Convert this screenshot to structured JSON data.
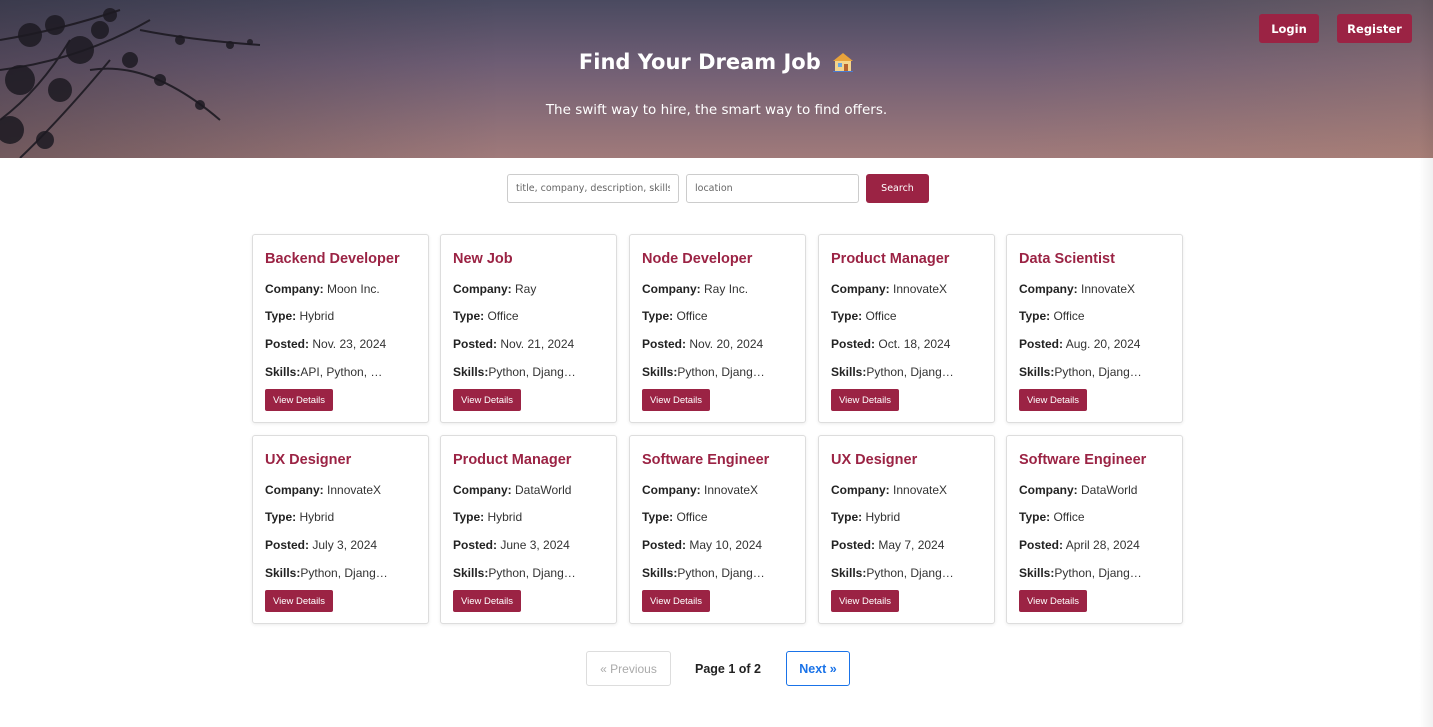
{
  "header": {
    "title": "Find Your Dream Job",
    "title_icon": "house-emoji",
    "subtitle": "The swift way to hire, the smart way to find offers.",
    "login_label": "Login",
    "register_label": "Register"
  },
  "search": {
    "query_placeholder": "title, company, description, skills",
    "query_value": "",
    "location_placeholder": "location",
    "location_value": "",
    "button_label": "Search"
  },
  "jobs": [
    {
      "title": "Backend Developer",
      "company": "Moon Inc.",
      "type": "Hybrid",
      "posted": "Nov. 23, 2024",
      "skills": "API, Python, …"
    },
    {
      "title": "New Job",
      "company": "Ray",
      "type": "Office",
      "posted": "Nov. 21, 2024",
      "skills": "Python, Djang…"
    },
    {
      "title": "Node Developer",
      "company": "Ray Inc.",
      "type": "Office",
      "posted": "Nov. 20, 2024",
      "skills": "Python, Djang…"
    },
    {
      "title": "Product Manager",
      "company": "InnovateX",
      "type": "Office",
      "posted": "Oct. 18, 2024",
      "skills": "Python, Djang…"
    },
    {
      "title": "Data Scientist",
      "company": "InnovateX",
      "type": "Office",
      "posted": "Aug. 20, 2024",
      "skills": "Python, Djang…"
    },
    {
      "title": "UX Designer",
      "company": "InnovateX",
      "type": "Hybrid",
      "posted": "July 3, 2024",
      "skills": "Python, Djang…"
    },
    {
      "title": "Product Manager",
      "company": "DataWorld",
      "type": "Hybrid",
      "posted": "June 3, 2024",
      "skills": "Python, Djang…"
    },
    {
      "title": "Software Engineer",
      "company": "InnovateX",
      "type": "Office",
      "posted": "May 10, 2024",
      "skills": "Python, Djang…"
    },
    {
      "title": "UX Designer",
      "company": "InnovateX",
      "type": "Hybrid",
      "posted": "May 7, 2024",
      "skills": "Python, Djang…"
    },
    {
      "title": "Software Engineer",
      "company": "DataWorld",
      "type": "Office",
      "posted": "April 28, 2024",
      "skills": "Python, Djang…"
    }
  ],
  "card_labels": {
    "company": "Company:",
    "type": "Type:",
    "posted": "Posted:",
    "skills": "Skills:",
    "view_details": "View Details"
  },
  "pagination": {
    "previous_label": "« Previous",
    "page_info": "Page 1 of 2",
    "next_label": "Next »"
  },
  "colors": {
    "accent": "#9b2344",
    "link_blue": "#1a73e8"
  }
}
